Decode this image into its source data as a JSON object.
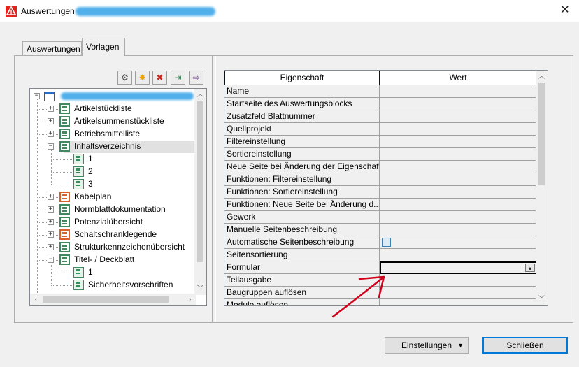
{
  "window": {
    "title": "Auswertungen",
    "close_glyph": "✕"
  },
  "tabs": [
    {
      "label": "Auswertungen",
      "active": false
    },
    {
      "label": "Vorlagen",
      "active": true
    }
  ],
  "toolbar": {
    "buttons": [
      {
        "name": "settings-icon",
        "glyph": "⚙"
      },
      {
        "name": "new-icon",
        "glyph": "✸"
      },
      {
        "name": "delete-icon",
        "glyph": "✖"
      },
      {
        "name": "import-icon",
        "glyph": "⇥"
      },
      {
        "name": "export-icon",
        "glyph": "⇨"
      }
    ]
  },
  "tree": {
    "items": [
      {
        "label": "Artikelstückliste",
        "level": 1,
        "icon": "green",
        "expander": "+"
      },
      {
        "label": "Artikelsummenstückliste",
        "level": 1,
        "icon": "green",
        "expander": "+"
      },
      {
        "label": "Betriebsmittelliste",
        "level": 1,
        "icon": "green",
        "expander": "+"
      },
      {
        "label": "Inhaltsverzeichnis",
        "level": 1,
        "icon": "green",
        "expander": "−",
        "selected": true
      },
      {
        "label": "1",
        "level": 2,
        "icon": "page",
        "expander": ""
      },
      {
        "label": "2",
        "level": 2,
        "icon": "page",
        "expander": ""
      },
      {
        "label": "3",
        "level": 2,
        "icon": "page",
        "expander": ""
      },
      {
        "label": "Kabelplan",
        "level": 1,
        "icon": "orange",
        "expander": "+"
      },
      {
        "label": "Normblattdokumentation",
        "level": 1,
        "icon": "green",
        "expander": "+"
      },
      {
        "label": "Potenzialübersicht",
        "level": 1,
        "icon": "green",
        "expander": "+"
      },
      {
        "label": "Schaltschranklegende",
        "level": 1,
        "icon": "orange",
        "expander": "+"
      },
      {
        "label": "Strukturkennzeichenübersicht",
        "level": 1,
        "icon": "green",
        "expander": "+"
      },
      {
        "label": "Titel- / Deckblatt",
        "level": 1,
        "icon": "green",
        "expander": "−"
      },
      {
        "label": "1",
        "level": 2,
        "icon": "page",
        "expander": ""
      },
      {
        "label": "Sicherheitsvorschriften",
        "level": 2,
        "icon": "page",
        "expander": ""
      }
    ]
  },
  "grid": {
    "headers": [
      "Eigenschaft",
      "Wert"
    ],
    "rows": [
      {
        "name": "Name",
        "value_type": "text"
      },
      {
        "name": "Startseite des Auswertungsblocks",
        "value_type": "text"
      },
      {
        "name": "Zusatzfeld Blattnummer",
        "value_type": "text"
      },
      {
        "name": "Quellprojekt",
        "value_type": "text"
      },
      {
        "name": "Filtereinstellung",
        "value_type": "text"
      },
      {
        "name": "Sortiereinstellung",
        "value_type": "text"
      },
      {
        "name": "Neue Seite bei Änderung der Eigenschaft",
        "value_type": "text"
      },
      {
        "name": "Funktionen: Filtereinstellung",
        "value_type": "text"
      },
      {
        "name": "Funktionen: Sortiereinstellung",
        "value_type": "text"
      },
      {
        "name": "Funktionen: Neue Seite bei Änderung d...",
        "value_type": "text"
      },
      {
        "name": "Gewerk",
        "value_type": "text"
      },
      {
        "name": "Manuelle Seitenbeschreibung",
        "value_type": "text"
      },
      {
        "name": "Automatische Seitenbeschreibung",
        "value_type": "checkbox"
      },
      {
        "name": "Seitensortierung",
        "value_type": "text"
      },
      {
        "name": "Formular",
        "value_type": "combo"
      },
      {
        "name": "Teilausgabe",
        "value_type": "text"
      },
      {
        "name": "Baugruppen auflösen",
        "value_type": "text"
      },
      {
        "name": "Module auflösen",
        "value_type": "text"
      }
    ]
  },
  "buttons": {
    "settings_label": "Einstellungen",
    "close_label": "Schließen"
  },
  "colors": {
    "annotation_arrow": "#d0021b",
    "selection_border": "#0078d7",
    "redacted_blur": "#3fa7e8"
  }
}
